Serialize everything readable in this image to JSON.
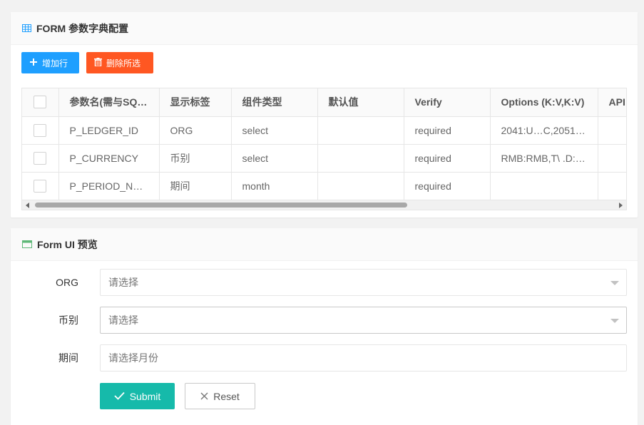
{
  "config_card": {
    "title": "FORM 参数字典配置",
    "add_label": "增加行",
    "delete_label": "删除所选",
    "columns": [
      "参数名(需与SQL中的参数名一致)",
      "显示标签",
      "组件类型",
      "默认值",
      "Verify",
      "Options (K:V,K:V)",
      "API"
    ],
    "rows": [
      {
        "name": "P_LEDGER_ID",
        "label": "ORG",
        "type": "select",
        "default": "",
        "verify": "required",
        "options": "2041:U…C,2051:…",
        "api": ""
      },
      {
        "name": "P_CURRENCY",
        "label": "币别",
        "type": "select",
        "default": "",
        "verify": "required",
        "options": "RMB:RMB,T\\ .D:…",
        "api": ""
      },
      {
        "name": "P_PERIOD_NAME",
        "label": "期间",
        "type": "month",
        "default": "",
        "verify": "required",
        "options": "",
        "api": ""
      }
    ]
  },
  "preview_card": {
    "title": "Form UI 预览",
    "fields": [
      {
        "label": "ORG",
        "placeholder": "请选择"
      },
      {
        "label": "币别",
        "placeholder": "请选择"
      },
      {
        "label": "期间",
        "placeholder": "请选择月份"
      }
    ],
    "submit_label": "Submit",
    "reset_label": "Reset"
  },
  "colors": {
    "add_button": "#1e9fff",
    "delete_button": "#ff5722",
    "submit_button": "#16baaa"
  }
}
